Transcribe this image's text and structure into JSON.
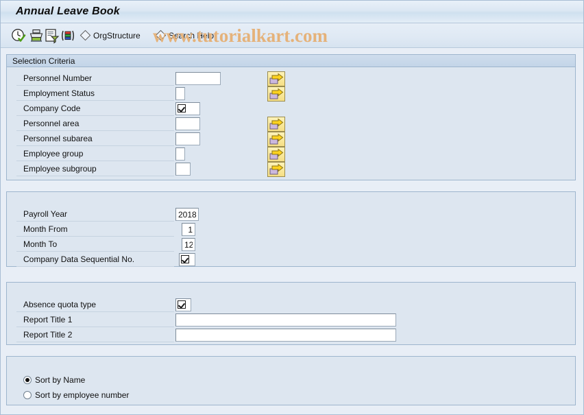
{
  "window": {
    "title": "Annual Leave Book"
  },
  "toolbar": {
    "icons": [
      {
        "name": "execute-icon",
        "label": "Execute"
      },
      {
        "name": "print-icon",
        "label": "Print"
      },
      {
        "name": "print-preview-icon",
        "label": "Print Preview"
      },
      {
        "name": "variant-icon",
        "label": "Get Variant"
      }
    ],
    "buttons": [
      {
        "name": "orgstructure-button",
        "label": "OrgStructure"
      },
      {
        "name": "search-help-button",
        "label": "Search Help"
      }
    ]
  },
  "watermark": {
    "text": "www.tutorialkart.com",
    "color": "#e5b27a"
  },
  "selection_criteria": {
    "header": "Selection Criteria",
    "fields": [
      {
        "label": "Personnel Number",
        "value": "",
        "input_width": 66,
        "has_checkbox": false,
        "has_arrow": true
      },
      {
        "label": "Employment Status",
        "value": "",
        "input_width": 14,
        "has_checkbox": false,
        "has_arrow": true
      },
      {
        "label": "Company Code",
        "value": "",
        "input_width": 36,
        "has_checkbox": true,
        "has_arrow": false
      },
      {
        "label": "Personnel area",
        "value": "",
        "input_width": 36,
        "has_checkbox": false,
        "has_arrow": true
      },
      {
        "label": "Personnel subarea",
        "value": "",
        "input_width": 36,
        "has_checkbox": false,
        "has_arrow": true
      },
      {
        "label": "Employee group",
        "value": "",
        "input_width": 14,
        "has_checkbox": false,
        "has_arrow": true
      },
      {
        "label": "Employee subgroup",
        "value": "",
        "input_width": 22,
        "has_checkbox": false,
        "has_arrow": true
      }
    ]
  },
  "period_section": {
    "fields": [
      {
        "label": "Payroll Year",
        "value": "2018",
        "input_width": 34,
        "has_checkbox": false
      },
      {
        "label": "Month From",
        "value": "1",
        "input_width": 20,
        "has_checkbox": false
      },
      {
        "label": "Month To",
        "value": "12",
        "input_width": 20,
        "has_checkbox": false
      },
      {
        "label": "Company Data Sequential No.",
        "value": "",
        "input_width": 24,
        "has_checkbox": true
      }
    ]
  },
  "report_section": {
    "fields": [
      {
        "label": "Absence quota type",
        "value": "",
        "input_width": 22,
        "has_checkbox": true
      },
      {
        "label": "Report Title 1",
        "value": "",
        "input_width": 322,
        "has_checkbox": false
      },
      {
        "label": "Report Title 2",
        "value": "",
        "input_width": 322,
        "has_checkbox": false
      }
    ]
  },
  "sort_section": {
    "options": [
      {
        "label": "Sort by Name",
        "selected": true
      },
      {
        "label": "Sort by employee number",
        "selected": false
      }
    ]
  }
}
